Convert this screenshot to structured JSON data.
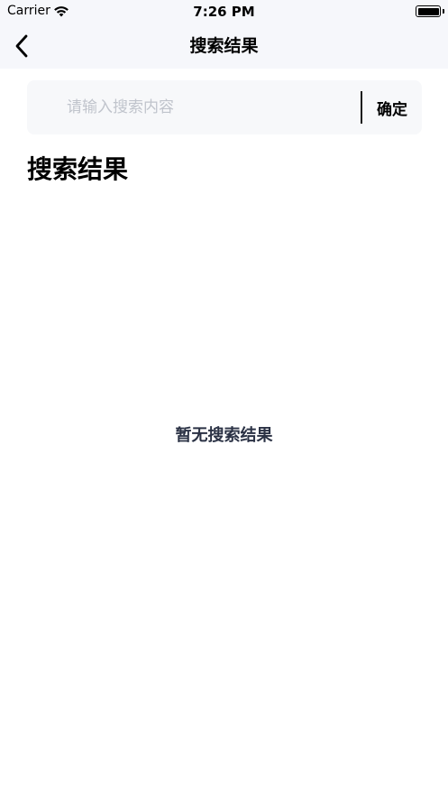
{
  "status_bar": {
    "carrier": "Carrier",
    "time": "7:26 PM",
    "wifi_icon": "wifi-icon",
    "battery_icon": "battery-icon"
  },
  "nav": {
    "title": "搜索结果",
    "back_icon": "chevron-left-icon"
  },
  "search": {
    "placeholder": "请输入搜索内容",
    "value": "",
    "confirm_label": "确定"
  },
  "section_title": "搜索结果",
  "empty_text": "暂无搜索结果",
  "colors": {
    "header_bg": "#f6f7fb",
    "search_bg": "#f7f8fa",
    "placeholder": "#c0c4cc",
    "empty_text": "#2b3245"
  }
}
